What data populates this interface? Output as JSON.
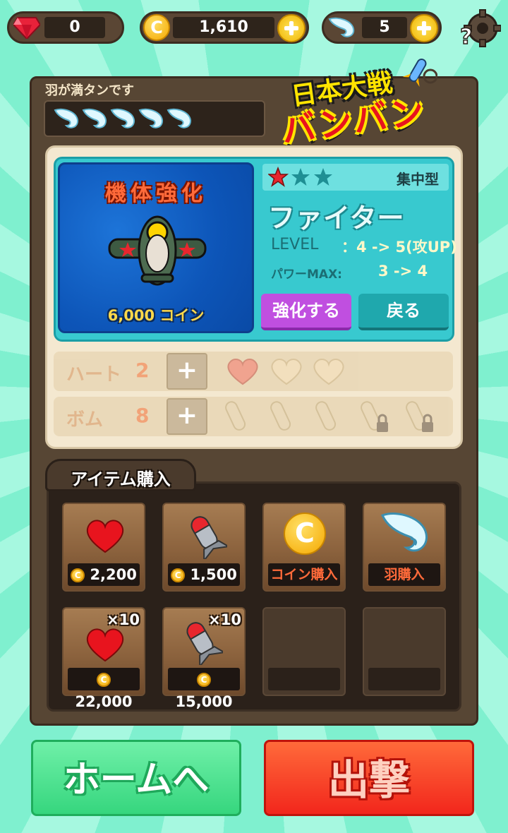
{
  "topbar": {
    "gems": "0",
    "coins": "1,610",
    "wings": "5"
  },
  "wing_status": "羽が満タンです",
  "logo": {
    "line1": "日本大戦",
    "line2": "バンバン"
  },
  "upgrade": {
    "title": "機体強化",
    "cost": "6,000 コイン",
    "type_label": "集中型",
    "name": "ファイター",
    "level_label": "LEVEL",
    "level_value": "：4 -> 5(攻UP)",
    "power_label": "パワーMAX:",
    "power_value": "3 -> 4",
    "upgrade_button": "強化する",
    "back_button": "戻る",
    "stars_filled": 1,
    "stars_total": 3
  },
  "hearts_row": {
    "label": "ハート",
    "count": "2"
  },
  "bombs_row": {
    "label": "ボム",
    "count": "8"
  },
  "shop": {
    "title": "アイテム購入",
    "items": [
      {
        "price": "2,200"
      },
      {
        "price": "1,500"
      },
      {
        "price": "コイン購入"
      },
      {
        "price": "羽購入"
      },
      {
        "price": "22,000",
        "badge": "×10"
      },
      {
        "price": "15,000",
        "badge": "×10"
      },
      {
        "price": ""
      },
      {
        "price": ""
      }
    ]
  },
  "buttons": {
    "home": "ホームへ",
    "sortie": "出撃"
  },
  "colors": {
    "accent_green": "#3fe38b",
    "accent_red": "#f23a22",
    "teal": "#38c9cf",
    "purple": "#c04fe0"
  }
}
